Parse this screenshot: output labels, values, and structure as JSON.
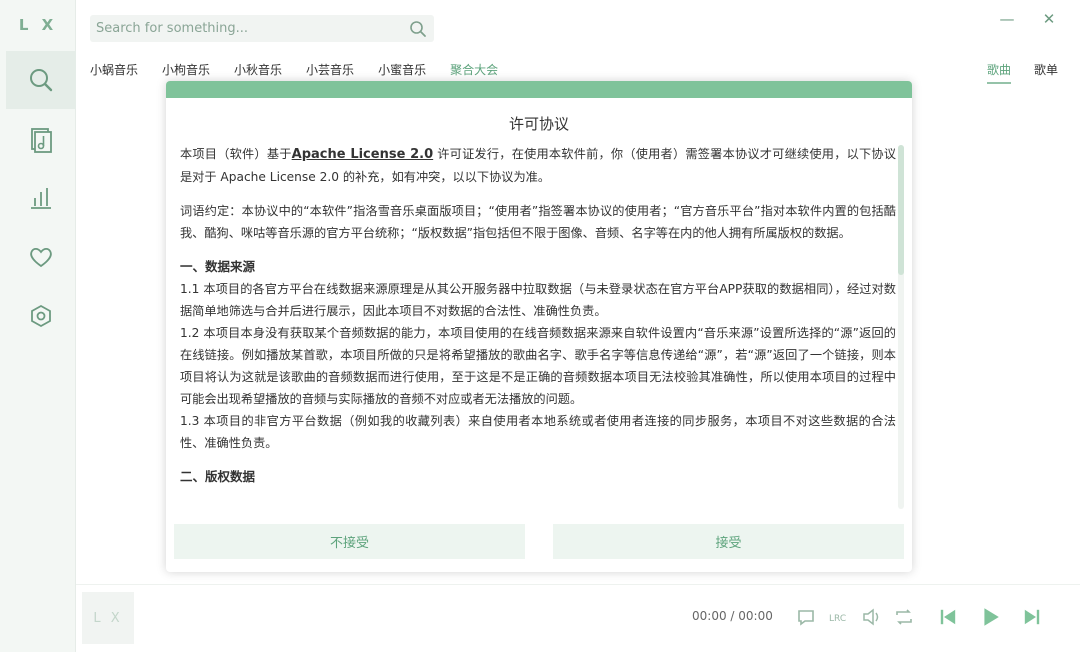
{
  "app": {
    "logo": "L X"
  },
  "search": {
    "placeholder": "Search for something..."
  },
  "sidebar": {
    "items": [
      {
        "name": "search",
        "icon": "search-icon"
      },
      {
        "name": "song-list",
        "icon": "music-list-icon"
      },
      {
        "name": "leaderboard",
        "icon": "bar-chart-icon"
      },
      {
        "name": "favorites",
        "icon": "heart-icon"
      },
      {
        "name": "settings",
        "icon": "settings-hexagon-icon"
      }
    ]
  },
  "window": {
    "minimize": "—",
    "close": "✕"
  },
  "sources": [
    "小蜗音乐",
    "小枸音乐",
    "小秋音乐",
    "小芸音乐",
    "小蜜音乐",
    "聚合大会"
  ],
  "type_tabs": [
    "歌曲",
    "歌单"
  ],
  "dialog": {
    "title": "许可协议",
    "intro_pre": "本项目（软件）基于",
    "intro_link": "Apache License 2.0",
    "intro_post": " 许可证发行，在使用本软件前，你（使用者）需签署本协议才可继续使用，以下协议是对于 Apache License 2.0 的补充，如有冲突，以以下协议为准。",
    "terms": "词语约定：本协议中的“本软件”指洛雪音乐桌面版项目；“使用者”指签署本协议的使用者；“官方音乐平台”指对本软件内置的包括酷我、酷狗、咪咕等音乐源的官方平台统称；“版权数据”指包括但不限于图像、音频、名字等在内的他人拥有所属版权的数据。",
    "section1_title": "一、数据来源",
    "s1_1": "1.1 本项目的各官方平台在线数据来源原理是从其公开服务器中拉取数据（与未登录状态在官方平台APP获取的数据相同），经过对数据简单地筛选与合并后进行展示，因此本项目不对数据的合法性、准确性负责。",
    "s1_2": "1.2 本项目本身没有获取某个音频数据的能力，本项目使用的在线音频数据来源来自软件设置内“音乐来源”设置所选择的“源”返回的在线链接。例如播放某首歌，本项目所做的只是将希望播放的歌曲名字、歌手名字等信息传递给“源”，若“源”返回了一个链接，则本项目将认为这就是该歌曲的音频数据而进行使用，至于这是不是正确的音频数据本项目无法校验其准确性，所以使用本项目的过程中可能会出现希望播放的音频与实际播放的音频不对应或者无法播放的问题。",
    "s1_3": "1.3 本项目的非官方平台数据（例如我的收藏列表）来自使用者本地系统或者使用者连接的同步服务，本项目不对这些数据的合法性、准确性负责。",
    "section2_title": "二、版权数据",
    "reject_label": "不接受",
    "accept_label": "接受"
  },
  "player": {
    "cover_text": "L X",
    "time": "00:00 / 00:00",
    "controls": [
      "comment-icon",
      "lyric-icon",
      "volume-icon",
      "loop-icon",
      "prev-icon",
      "play-icon",
      "next-icon"
    ]
  },
  "colors": {
    "accent": "#5da37c",
    "header": "#7fc39a",
    "sidebar_bg": "#f3f7f4"
  }
}
